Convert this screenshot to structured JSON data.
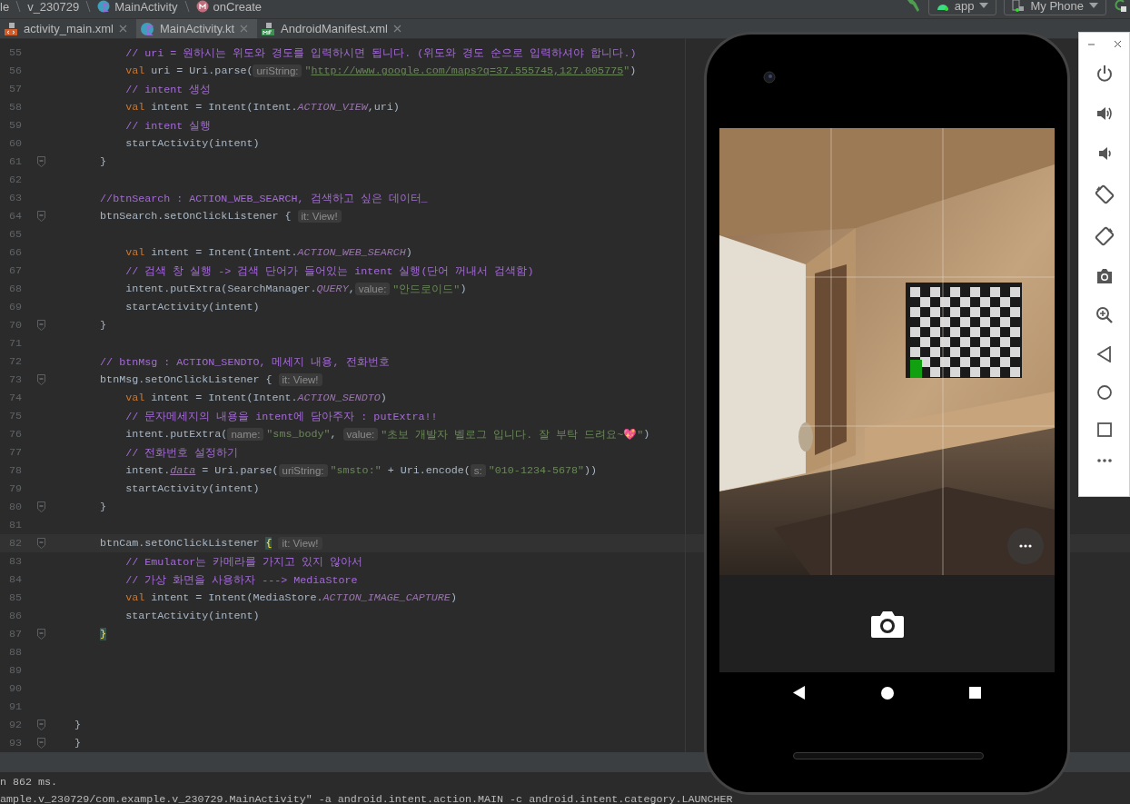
{
  "breadcrumb": [
    "le",
    "v_230729",
    "MainActivity",
    "onCreate"
  ],
  "toolbar": {
    "run_config": "app",
    "device": "My Phone"
  },
  "tabs": [
    {
      "label": "activity_main.xml",
      "selected": false
    },
    {
      "label": "MainActivity.kt",
      "selected": true
    },
    {
      "label": "AndroidManifest.xml",
      "selected": false
    }
  ],
  "lines": [
    {
      "number": "55",
      "fold": false,
      "current": false,
      "tokens": [
        {
          "kind": "comment",
          "text": "            // uri = 원하시는 위도와 경도를 입력하시면 됩니다. (위도와 경도 순으로 입력하셔야 합니다.)"
        }
      ]
    },
    {
      "number": "56",
      "fold": false,
      "current": false,
      "tokens": [
        {
          "kind": "keyword",
          "text": "            val"
        },
        {
          "kind": "plain",
          "text": " uri = Uri.parse("
        },
        {
          "kind": "hint",
          "text": "uriString:"
        },
        {
          "kind": "string",
          "text": "\""
        },
        {
          "kind": "link",
          "text": "http://www.google.com/maps?q=37.555745,127.005775"
        },
        {
          "kind": "string",
          "text": "\""
        },
        {
          "kind": "plain",
          "text": ")"
        }
      ]
    },
    {
      "number": "57",
      "fold": false,
      "current": false,
      "tokens": [
        {
          "kind": "comment",
          "text": "            // intent 생성"
        }
      ]
    },
    {
      "number": "58",
      "fold": false,
      "current": false,
      "tokens": [
        {
          "kind": "keyword",
          "text": "            val"
        },
        {
          "kind": "plain",
          "text": " intent = Intent(Intent."
        },
        {
          "kind": "constant",
          "text": "ACTION_VIEW"
        },
        {
          "kind": "plain",
          "text": ",uri)"
        }
      ]
    },
    {
      "number": "59",
      "fold": false,
      "current": false,
      "tokens": [
        {
          "kind": "comment",
          "text": "            // intent 실행"
        }
      ]
    },
    {
      "number": "60",
      "fold": false,
      "current": false,
      "tokens": [
        {
          "kind": "plain",
          "text": "            startActivity(intent)"
        }
      ]
    },
    {
      "number": "61",
      "fold": true,
      "current": false,
      "tokens": [
        {
          "kind": "plain",
          "text": "        }"
        }
      ]
    },
    {
      "number": "62",
      "fold": false,
      "current": false
    },
    {
      "number": "63",
      "fold": false,
      "current": false,
      "tokens": [
        {
          "kind": "comment",
          "text": "        //btnSearch : ACTION_WEB_SEARCH, 검색하고 싶은 데이터_"
        }
      ]
    },
    {
      "number": "64",
      "fold": true,
      "current": false,
      "tokens": [
        {
          "kind": "plain",
          "text": "        btnSearch.setOnClickListener { "
        },
        {
          "kind": "hint",
          "text": "it: View!"
        }
      ]
    },
    {
      "number": "65",
      "fold": false,
      "current": false
    },
    {
      "number": "66",
      "fold": false,
      "current": false,
      "tokens": [
        {
          "kind": "keyword",
          "text": "            val"
        },
        {
          "kind": "plain",
          "text": " intent = Intent(Intent."
        },
        {
          "kind": "constant",
          "text": "ACTION_WEB_SEARCH"
        },
        {
          "kind": "plain",
          "text": ")"
        }
      ]
    },
    {
      "number": "67",
      "fold": false,
      "current": false,
      "tokens": [
        {
          "kind": "comment",
          "text": "            // 검색 창 실행 -> 검색 단어가 들어있는 intent 실행(단어 꺼내서 검색함)"
        }
      ]
    },
    {
      "number": "68",
      "fold": false,
      "current": false,
      "tokens": [
        {
          "kind": "plain",
          "text": "            intent.putExtra(SearchManager."
        },
        {
          "kind": "constant",
          "text": "QUERY"
        },
        {
          "kind": "plain",
          "text": ","
        },
        {
          "kind": "hint",
          "text": "value:"
        },
        {
          "kind": "string",
          "text": "\"안드로이드\""
        },
        {
          "kind": "plain",
          "text": ")"
        }
      ]
    },
    {
      "number": "69",
      "fold": false,
      "current": false,
      "tokens": [
        {
          "kind": "plain",
          "text": "            startActivity(intent)"
        }
      ]
    },
    {
      "number": "70",
      "fold": true,
      "current": false,
      "tokens": [
        {
          "kind": "plain",
          "text": "        }"
        }
      ]
    },
    {
      "number": "71",
      "fold": false,
      "current": false
    },
    {
      "number": "72",
      "fold": false,
      "current": false,
      "tokens": [
        {
          "kind": "comment",
          "text": "        // btnMsg : ACTION_SENDTO, 메세지 내용, 전화번호"
        }
      ]
    },
    {
      "number": "73",
      "fold": true,
      "current": false,
      "tokens": [
        {
          "kind": "plain",
          "text": "        btnMsg.setOnClickListener { "
        },
        {
          "kind": "hint",
          "text": "it: View!"
        }
      ]
    },
    {
      "number": "74",
      "fold": false,
      "current": false,
      "tokens": [
        {
          "kind": "keyword",
          "text": "            val"
        },
        {
          "kind": "plain",
          "text": " intent = Intent(Intent."
        },
        {
          "kind": "constant",
          "text": "ACTION_SENDTO"
        },
        {
          "kind": "plain",
          "text": ")"
        }
      ]
    },
    {
      "number": "75",
      "fold": false,
      "current": false,
      "tokens": [
        {
          "kind": "comment",
          "text": "            // 문자메세지의 내용을 intent에 담아주자 : putExtra!!"
        }
      ]
    },
    {
      "number": "76",
      "fold": false,
      "current": false,
      "tokens": [
        {
          "kind": "plain",
          "text": "            intent.putExtra("
        },
        {
          "kind": "hint",
          "text": "name:"
        },
        {
          "kind": "string",
          "text": "\"sms_body\""
        },
        {
          "kind": "plain",
          "text": ", "
        },
        {
          "kind": "hint",
          "text": "value:"
        },
        {
          "kind": "string",
          "text": "\"초보 개발자 벨로그 입니다. 잘 부탁 드려요~💖\""
        },
        {
          "kind": "plain",
          "text": ")"
        }
      ]
    },
    {
      "number": "77",
      "fold": false,
      "current": false,
      "tokens": [
        {
          "kind": "comment",
          "text": "            // 전화번호 설정하기"
        }
      ]
    },
    {
      "number": "78",
      "fold": false,
      "current": false,
      "tokens": [
        {
          "kind": "plain",
          "text": "            intent."
        },
        {
          "kind": "property",
          "text": "data"
        },
        {
          "kind": "plain",
          "text": " = Uri.parse("
        },
        {
          "kind": "hint",
          "text": "uriString:"
        },
        {
          "kind": "string",
          "text": "\"smsto:\""
        },
        {
          "kind": "plain",
          "text": " + Uri.encode("
        },
        {
          "kind": "hint",
          "text": "s:"
        },
        {
          "kind": "string",
          "text": "\"010-1234-5678\""
        },
        {
          "kind": "plain",
          "text": "))"
        }
      ]
    },
    {
      "number": "79",
      "fold": false,
      "current": false,
      "tokens": [
        {
          "kind": "plain",
          "text": "            startActivity(intent)"
        }
      ]
    },
    {
      "number": "80",
      "fold": true,
      "current": false,
      "tokens": [
        {
          "kind": "plain",
          "text": "        }"
        }
      ]
    },
    {
      "number": "81",
      "fold": false,
      "current": false
    },
    {
      "number": "82",
      "fold": true,
      "current": true,
      "tokens": [
        {
          "kind": "plain",
          "text": "        btnCam.setOnClickListener "
        },
        {
          "kind": "brace",
          "text": "{"
        },
        {
          "kind": "hint",
          "text": "it: View!"
        }
      ]
    },
    {
      "number": "83",
      "fold": false,
      "current": false,
      "tokens": [
        {
          "kind": "comment",
          "text": "            // Emulator는 카메라를 가지고 있지 않아서"
        }
      ]
    },
    {
      "number": "84",
      "fold": false,
      "current": false,
      "tokens": [
        {
          "kind": "comment",
          "text": "            // 가상 화면을 사용하자 ---> MediaStore"
        }
      ]
    },
    {
      "number": "85",
      "fold": false,
      "current": false,
      "tokens": [
        {
          "kind": "keyword",
          "text": "            val"
        },
        {
          "kind": "plain",
          "text": " intent = Intent(MediaStore."
        },
        {
          "kind": "constant",
          "text": "ACTION_IMAGE_CAPTURE"
        },
        {
          "kind": "plain",
          "text": ")"
        }
      ]
    },
    {
      "number": "86",
      "fold": false,
      "current": false,
      "tokens": [
        {
          "kind": "plain",
          "text": "            startActivity(intent)"
        }
      ]
    },
    {
      "number": "87",
      "fold": true,
      "current": false,
      "tokens": [
        {
          "kind": "brace",
          "text": "        }"
        }
      ]
    },
    {
      "number": "88",
      "fold": false,
      "current": false
    },
    {
      "number": "89",
      "fold": false,
      "current": false
    },
    {
      "number": "90",
      "fold": false,
      "current": false
    },
    {
      "number": "91",
      "fold": false,
      "current": false
    },
    {
      "number": "92",
      "fold": true,
      "current": false,
      "tokens": [
        {
          "kind": "plain",
          "text": "    }"
        }
      ]
    },
    {
      "number": "93",
      "fold": true,
      "current": false,
      "tokens": [
        {
          "kind": "plain",
          "text": "    }"
        }
      ]
    }
  ],
  "log": [
    "n 862 ms.",
    "ample.v_230729/com.example.v_230729.MainActivity\" -a android.intent.action.MAIN -c android.intent.category.LAUNCHER"
  ]
}
